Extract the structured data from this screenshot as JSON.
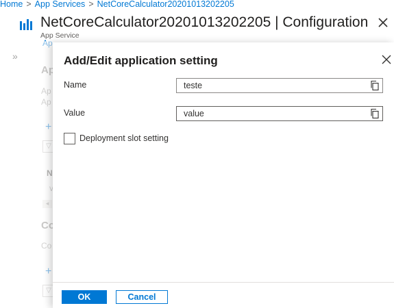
{
  "breadcrumb": {
    "items": [
      "Home",
      "App Services",
      "NetCoreCalculator20201013202205"
    ],
    "separator": ">"
  },
  "header": {
    "title": "NetCoreCalculator20201013202205 | Configuration",
    "subtitle": "App Service",
    "icon": "app-service-icon",
    "close_icon": "close-icon"
  },
  "background": {
    "fragments": {
      "tab": "Ap",
      "section1_heading": "Ap",
      "section1_line1": "Ap",
      "section1_line2": "Ap",
      "add_glyph": "+",
      "filter_glyph": "▽",
      "col_header": "N",
      "row_glyph": "v",
      "scroll_glyph": "◂",
      "section2_heading": "Co",
      "section2_line": "Co",
      "add2_glyph": "+",
      "filter2_glyph": "▽"
    },
    "expand_icon": "»"
  },
  "dialog": {
    "title": "Add/Edit application setting",
    "name_label": "Name",
    "name_value": "teste",
    "value_label": "Value",
    "value_value": "value",
    "checkbox_label": "Deployment slot setting",
    "checkbox_checked": false,
    "ok_label": "OK",
    "cancel_label": "Cancel"
  },
  "colors": {
    "accent": "#0078d4",
    "text": "#323130",
    "border": "#8a8886"
  }
}
